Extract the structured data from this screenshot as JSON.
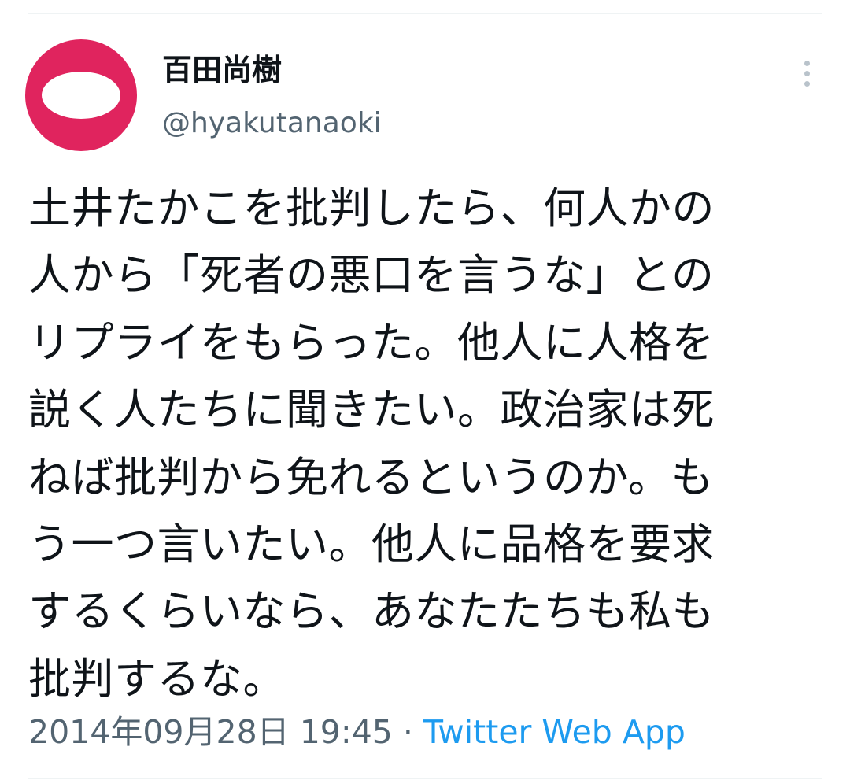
{
  "user": {
    "display_name": "百田尚樹",
    "handle": "@hyakutanaoki",
    "avatar_colors": {
      "ring": "#e0245e",
      "inner": "#ffffff"
    }
  },
  "tweet": {
    "lines": [
      "土井たかこを批判したら、何人かの",
      "人から「死者の悪口を言うな」との",
      "リプライをもらった。他人に人格を",
      "説く人たちに聞きたい。政治家は死",
      "ねば批判から免れるというのか。も",
      "う一つ言いたい。他人に品格を要求",
      "するくらいなら、あなたたちも私も",
      "批判するな。"
    ],
    "timestamp": "2014年09月28日 19:45",
    "separator": " · ",
    "source": "Twitter Web App"
  },
  "icons": {
    "more": "more-vertical-icon"
  },
  "colors": {
    "text": "#0f1419",
    "secondary": "#536471",
    "link": "#1d9bf0"
  }
}
